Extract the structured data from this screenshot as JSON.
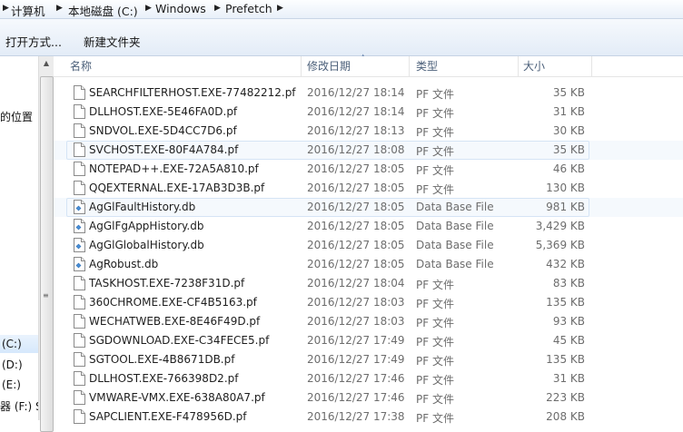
{
  "address": {
    "segments": [
      "计算机",
      "本地磁盘 (C:)",
      "Windows",
      "Prefetch"
    ]
  },
  "toolbar": {
    "open_with": "打开方式...",
    "new_folder": "新建文件夹"
  },
  "nav": {
    "items": [
      {
        "label": "的位置"
      },
      {
        "label": "(C:)"
      },
      {
        "label": "(D:)"
      },
      {
        "label": "(E:)"
      },
      {
        "label": "器 (F:) S"
      }
    ]
  },
  "columns": {
    "name": "名称",
    "date": "修改日期",
    "type": "类型",
    "size": "大小"
  },
  "files": [
    {
      "name": "SEARCHFILTERHOST.EXE-77482212.pf",
      "date": "2016/12/27 18:14",
      "type": "PF 文件",
      "size": "35 KB",
      "icon": "file-icon"
    },
    {
      "name": "DLLHOST.EXE-5E46FA0D.pf",
      "date": "2016/12/27 18:14",
      "type": "PF 文件",
      "size": "31 KB",
      "icon": "file-icon"
    },
    {
      "name": "SNDVOL.EXE-5D4CC7D6.pf",
      "date": "2016/12/27 18:13",
      "type": "PF 文件",
      "size": "30 KB",
      "icon": "file-icon"
    },
    {
      "name": "SVCHOST.EXE-80F4A784.pf",
      "date": "2016/12/27 18:08",
      "type": "PF 文件",
      "size": "35 KB",
      "icon": "file-icon"
    },
    {
      "name": "NOTEPAD++.EXE-72A5A810.pf",
      "date": "2016/12/27 18:05",
      "type": "PF 文件",
      "size": "46 KB",
      "icon": "file-icon"
    },
    {
      "name": "QQEXTERNAL.EXE-17AB3D3B.pf",
      "date": "2016/12/27 18:05",
      "type": "PF 文件",
      "size": "130 KB",
      "icon": "file-icon"
    },
    {
      "name": "AgGlFaultHistory.db",
      "date": "2016/12/27 18:05",
      "type": "Data Base File",
      "size": "981 KB",
      "icon": "db-file-icon"
    },
    {
      "name": "AgGlFgAppHistory.db",
      "date": "2016/12/27 18:05",
      "type": "Data Base File",
      "size": "3,429 KB",
      "icon": "db-file-icon"
    },
    {
      "name": "AgGlGlobalHistory.db",
      "date": "2016/12/27 18:05",
      "type": "Data Base File",
      "size": "5,369 KB",
      "icon": "db-file-icon"
    },
    {
      "name": "AgRobust.db",
      "date": "2016/12/27 18:05",
      "type": "Data Base File",
      "size": "432 KB",
      "icon": "db-file-icon"
    },
    {
      "name": "TASKHOST.EXE-7238F31D.pf",
      "date": "2016/12/27 18:04",
      "type": "PF 文件",
      "size": "83 KB",
      "icon": "file-icon"
    },
    {
      "name": "360CHROME.EXE-CF4B5163.pf",
      "date": "2016/12/27 18:03",
      "type": "PF 文件",
      "size": "135 KB",
      "icon": "file-icon"
    },
    {
      "name": "WECHATWEB.EXE-8E46F49D.pf",
      "date": "2016/12/27 18:03",
      "type": "PF 文件",
      "size": "93 KB",
      "icon": "file-icon"
    },
    {
      "name": "SGDOWNLOAD.EXE-C34FECE5.pf",
      "date": "2016/12/27 17:49",
      "type": "PF 文件",
      "size": "45 KB",
      "icon": "file-icon"
    },
    {
      "name": "SGTOOL.EXE-4B8671DB.pf",
      "date": "2016/12/27 17:49",
      "type": "PF 文件",
      "size": "135 KB",
      "icon": "file-icon"
    },
    {
      "name": "DLLHOST.EXE-766398D2.pf",
      "date": "2016/12/27 17:46",
      "type": "PF 文件",
      "size": "31 KB",
      "icon": "file-icon"
    },
    {
      "name": "VMWARE-VMX.EXE-638A80A7.pf",
      "date": "2016/12/27 17:46",
      "type": "PF 文件",
      "size": "223 KB",
      "icon": "file-icon"
    },
    {
      "name": "SAPCLIENT.EXE-F478956D.pf",
      "date": "2016/12/27 17:38",
      "type": "PF 文件",
      "size": "208 KB",
      "icon": "file-icon"
    }
  ],
  "colors": {
    "accent": "#cfe3fa",
    "row_highlight": "#f5f9fd",
    "header_text": "#4c607a"
  }
}
